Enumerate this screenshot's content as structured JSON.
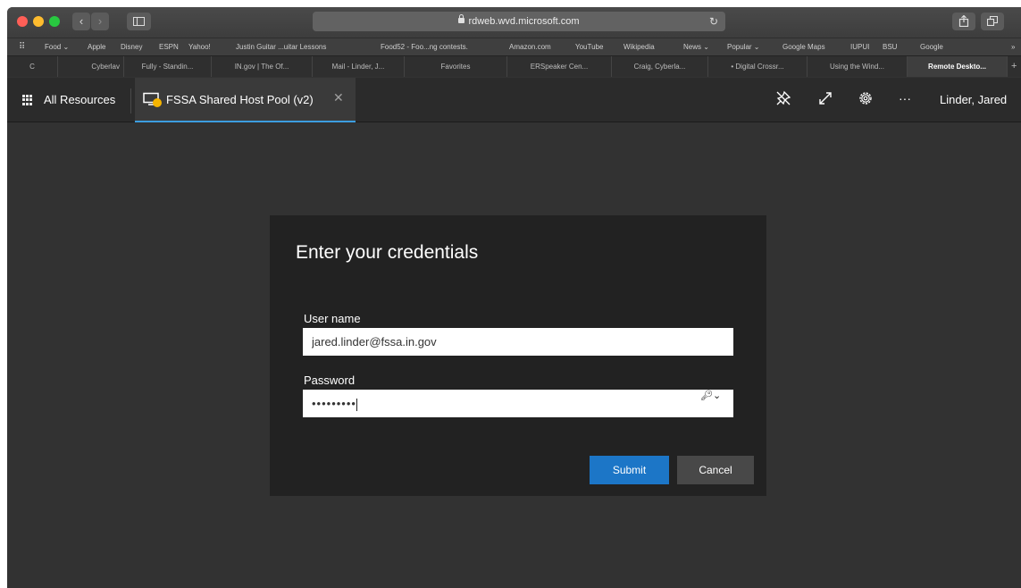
{
  "colors": {
    "close_light": "#ff5f57",
    "minimize_light": "#febc2e",
    "zoom_light": "#28c840",
    "accent": "#3c9de0",
    "submit_bg": "#1c76c7",
    "dialog_bg": "#222222"
  },
  "browser": {
    "back_glyph": "‹",
    "forward_glyph": "›",
    "sidebar_icon": "sidebar-icon",
    "url": "rdweb.wvd.microsoft.com",
    "reload_glyph": "↻",
    "share_icon": "share-icon",
    "tabs_icon": "tabs-overview-icon"
  },
  "bookmarks": {
    "grid_glyph": "⠿",
    "items": [
      "Food ⌄",
      "Apple",
      "Disney",
      "ESPN",
      "Yahoo!",
      "Justin Guitar ...uitar Lessons",
      "Food52 - Foo...ng contests.",
      "Amazon.com",
      "YouTube",
      "Wikipedia",
      "News ⌄",
      "Popular ⌄",
      "Google Maps",
      "IUPUI",
      "BSU",
      "Google"
    ],
    "overflow": "»"
  },
  "tabs": [
    {
      "label": "C"
    },
    {
      "label": "Cyberlav"
    },
    {
      "label": "Fully - Standin..."
    },
    {
      "label": "IN.gov | The Of..."
    },
    {
      "label": "Mail - Linder, J..."
    },
    {
      "label": "Favorites"
    },
    {
      "label": "ERSpeaker Cen..."
    },
    {
      "label": "Craig, Cyberla..."
    },
    {
      "label": "• Digital Crossr..."
    },
    {
      "label": "Using the Wind..."
    },
    {
      "label": "Remote Deskto..."
    }
  ],
  "new_tab_glyph": "+",
  "app": {
    "all_resources": "All Resources",
    "session_tab": "FSSA Shared Host Pool (v2)",
    "close_glyph": "✕",
    "more_glyph": "···",
    "user": "Linder, Jared"
  },
  "dialog": {
    "title": "Enter your credentials",
    "username_label": "User name",
    "username_value": "jared.linder@fssa.in.gov",
    "password_label": "Password",
    "password_value": "•••••••••",
    "key_glyph": "🔑︎⌄",
    "submit": "Submit",
    "cancel": "Cancel"
  }
}
